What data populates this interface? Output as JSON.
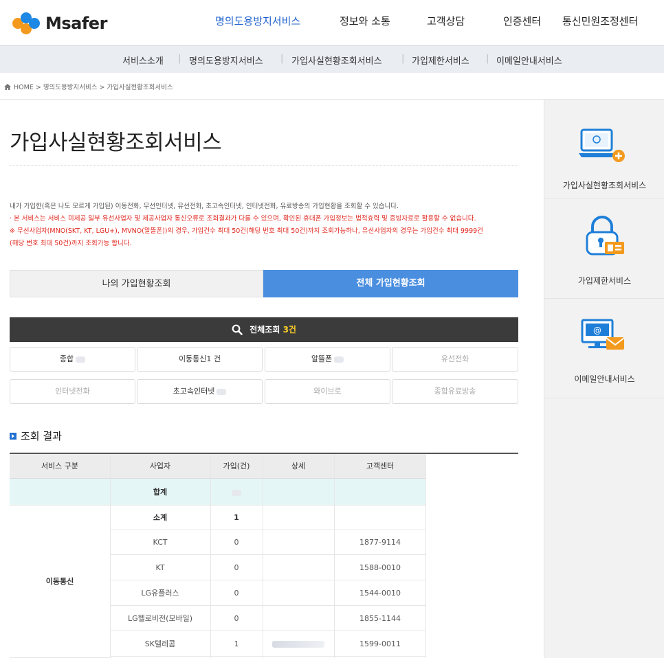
{
  "header": {
    "brand": "Msafer",
    "colors": {
      "accent": "#1b5fcc",
      "logo_orange": "#f39a1e",
      "logo_blue": "#1e88e5"
    },
    "gnb": [
      {
        "label": "명의도용방지서비스",
        "active": true
      },
      {
        "label": "정보와 소통",
        "active": false
      },
      {
        "label": "고객상담",
        "active": false
      },
      {
        "label": "인증센터",
        "active": false
      },
      {
        "label": "통신민원조정센터",
        "active": false
      }
    ]
  },
  "subnav": [
    "서비스소개",
    "명의도용방지서비스",
    "가입사실현황조회서비스",
    "가입제한서비스",
    "이메일안내서비스"
  ],
  "breadcrumb": {
    "icon": "home-icon",
    "text": "HOME > 명의도용방지서비스 > 가입사실현황조회서비스"
  },
  "page": {
    "title": "가입사실현황조회서비스",
    "desc_line1": "내가 가입한(혹은 나도 모르게 가입된) 이동전화, 무선인터넷, 유선전화, 초고속인터넷, 인터넷전화, 유료방송의 가입현황을 조회할 수 있습니다.",
    "desc_line2": "· 본 서비스는 서비스 미제공 일부 유선사업자 및 제공사업자 통신오류로 조회결과가 다를 수 있으며, 확인된 휴대폰 가입정보는 법적효력 및 증빙자료로 활용할 수 없습니다.",
    "desc_line3": "※ 무선사업자(MNO(SKT, KT, LGU+), MVNO(알뜰폰))의 경우, 가입건수 최대 50건(해당 번호 최대 50건)까지 조회가능하나, 유선사업자의 경우는 가입건수 최대 9999건",
    "desc_line4": "(해당 번호 최대 50건)까지 조회가능 합니다."
  },
  "tabs": {
    "my": "나의 가입현황조회",
    "all": "전체 가입현황조회"
  },
  "total": {
    "icon": "search-icon",
    "label": "전체조회",
    "count": "3건"
  },
  "categories": [
    {
      "label": "종합",
      "value": "",
      "enabled": true,
      "masked": true
    },
    {
      "label": "이동통신",
      "value": "1 건",
      "enabled": true,
      "masked": false
    },
    {
      "label": "알뜰폰",
      "value": "",
      "enabled": true,
      "masked": true
    },
    {
      "label": "유선전화",
      "value": "",
      "enabled": false,
      "masked": false
    },
    {
      "label": "인터넷전화",
      "value": "",
      "enabled": false,
      "masked": false
    },
    {
      "label": "초고속인터넷",
      "value": "",
      "enabled": true,
      "masked": true
    },
    {
      "label": "와이브로",
      "value": "",
      "enabled": false,
      "masked": false
    },
    {
      "label": "종합유료방송",
      "value": "",
      "enabled": false,
      "masked": false
    }
  ],
  "results": {
    "heading": "조회 결과",
    "columns": [
      "서비스 구분",
      "사업자",
      "가입(건)",
      "상세",
      "고객센터"
    ],
    "sum_label": "합계",
    "subtotal_label": "소계",
    "subtotal_value": "1",
    "group": "이동통신",
    "rows": [
      {
        "carrier": "KCT",
        "count": "0",
        "detail": "",
        "phone": "1877-9114"
      },
      {
        "carrier": "KT",
        "count": "0",
        "detail": "",
        "phone": "1588-0010"
      },
      {
        "carrier": "LG유플러스",
        "count": "0",
        "detail": "",
        "phone": "1544-0010"
      },
      {
        "carrier": "LG헬로비전(모바일)",
        "count": "0",
        "detail": "",
        "phone": "1855-1144"
      },
      {
        "carrier": "SK텔레콤",
        "count": "1",
        "detail": "masked",
        "phone": "1599-0011"
      }
    ]
  },
  "sidebar": [
    {
      "label": "가입사실현황조회서비스",
      "icon": "laptop-search-icon"
    },
    {
      "label": "가입제한서비스",
      "icon": "lock-card-icon"
    },
    {
      "label": "이메일안내서비스",
      "icon": "monitor-mail-icon"
    }
  ]
}
